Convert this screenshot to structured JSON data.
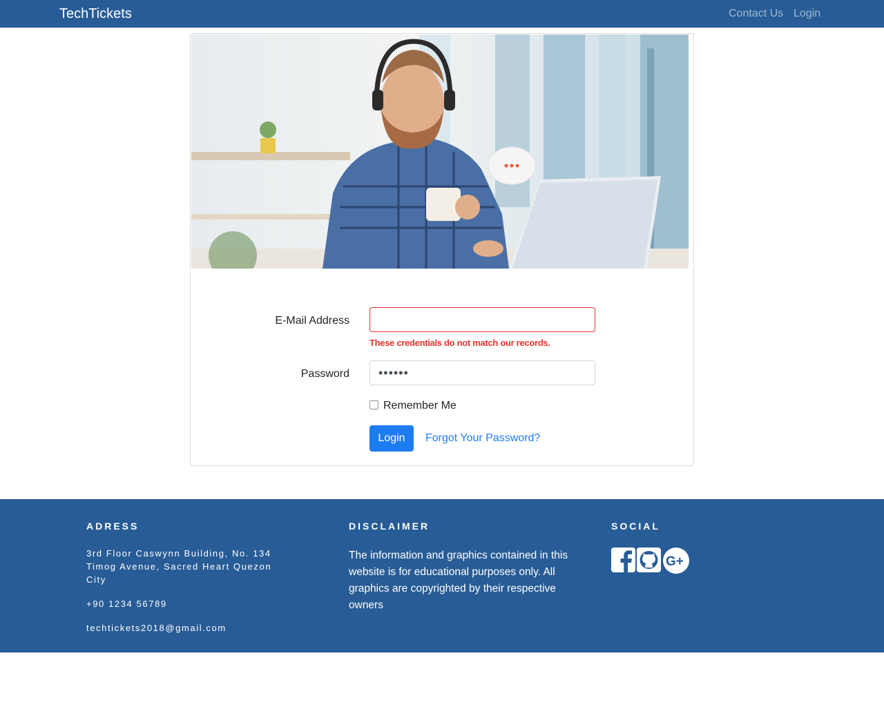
{
  "navbar": {
    "brand": "TechTickets",
    "links": [
      {
        "label": "Contact Us"
      },
      {
        "label": "Login"
      }
    ]
  },
  "login_form": {
    "email_label": "E-Mail Address",
    "email_value": "",
    "email_error": "These credentials do not match our records.",
    "password_label": "Password",
    "password_value": "••••••",
    "remember_label": "Remember Me",
    "remember_checked": false,
    "login_button": "Login",
    "forgot_link": "Forgot Your Password?"
  },
  "footer": {
    "address_heading": "ADRESS",
    "address_line1": "3rd Floor Caswynn Building, No. 134",
    "address_line2": "Timog Avenue, Sacred Heart Quezon",
    "address_line3": "City",
    "phone": "+90 1234 56789",
    "email": "techtickets2018@gmail.com",
    "disclaimer_heading": "DISCLAIMER",
    "disclaimer_text": "The information and graphics contained in this website is for educational purposes only. All graphics are copyrighted by their respective owners",
    "social_heading": "SOCIAL",
    "social_icons": [
      "facebook-icon",
      "github-icon",
      "google-plus-icon"
    ]
  },
  "colors": {
    "primary": "#275c96",
    "button": "#1e7cf2",
    "error": "#e3342f"
  }
}
